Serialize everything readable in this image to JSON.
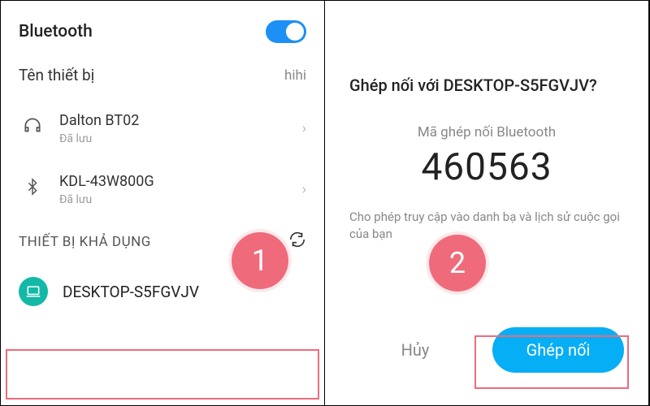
{
  "left": {
    "bluetooth_label": "Bluetooth",
    "device_name_label": "Tên thiết bị",
    "device_name_value": "hihi",
    "saved_devices": [
      {
        "name": "Dalton BT02",
        "status": "Đã lưu",
        "icon": "headphones-icon"
      },
      {
        "name": "KDL-43W800G",
        "status": "Đã lưu",
        "icon": "bluetooth-icon"
      }
    ],
    "available_section": "THIẾT BỊ KHẢ DỤNG",
    "available_device": "DESKTOP-S5FGVJV",
    "step": "1"
  },
  "right": {
    "title": "Ghép nối với DESKTOP-S5FGVJV?",
    "pairing_label": "Mã ghép nối Bluetooth",
    "pairing_code": "460563",
    "permission_text": "Cho phép truy cập vào danh bạ và lịch sử cuộc gọi của bạn",
    "cancel": "Hủy",
    "pair": "Ghép nối",
    "step": "2"
  }
}
